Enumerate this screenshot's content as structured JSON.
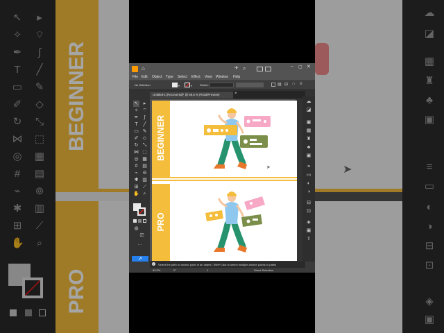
{
  "background": {
    "left_labels": [
      "BEGINNER",
      "PRO"
    ],
    "right_labels": []
  },
  "menu": {
    "items": [
      "File",
      "Edit",
      "Object",
      "Type",
      "Select",
      "Effect",
      "View",
      "Window",
      "Help"
    ]
  },
  "control_bar": {
    "selection": "No Selection",
    "stroke_label": "Stroke:"
  },
  "document_tab": {
    "title": "Untitled-1 [Recovered]* @ 69.5 % (RGB/Preview)",
    "close": "×"
  },
  "artboard": {
    "top_label": "BEGINNER",
    "bottom_label": "PRO"
  },
  "colors": {
    "accent_yellow": "#f4bd3c",
    "panel_dark": "#323232",
    "menu_bg": "#535353"
  },
  "status": {
    "zoom": "69.5%",
    "rotation": "0°",
    "artboard_index": "1",
    "tool_name": "Direct Selection",
    "tip": "Select the path or anchor point of an object  |  Shift+Click to select multiple anchor points or paths"
  }
}
